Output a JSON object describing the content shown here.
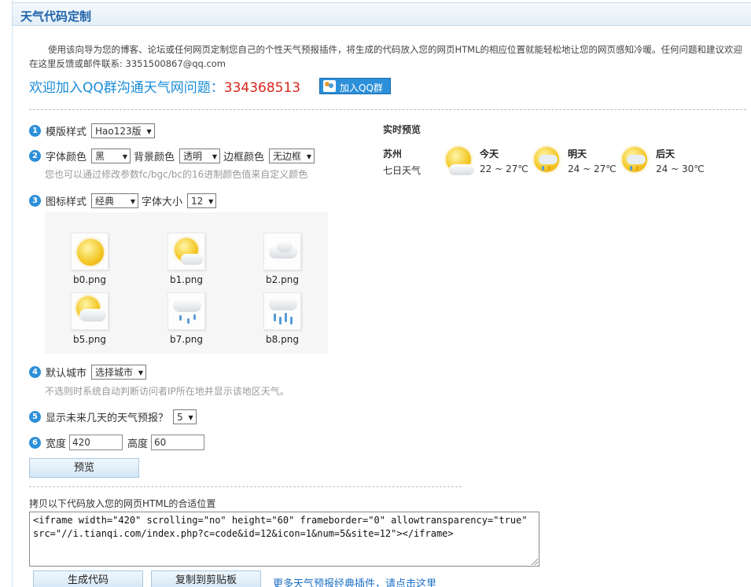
{
  "title": "天气代码定制",
  "intro": "使用该向导为您的博客、论坛或任何网页定制您自己的个性天气预报插件，将生成的代码放入您的网页HTML的相应位置就能轻松地让您的网页感知冷暖。任何问题和建议欢迎在这里反馈或邮件联系: 3351500867@qq.com",
  "qq": {
    "text": "欢迎加入QQ群沟通天气网问题：",
    "number": "334368513",
    "button": "加入QQ群"
  },
  "step1": {
    "num": "1",
    "label": "模版样式",
    "select": "Hao123版"
  },
  "step2": {
    "num": "2",
    "font_color_label": "字体颜色",
    "font_color": "黑",
    "bg_color_label": "背景颜色",
    "bg_color": "透明",
    "border_color_label": "边框颜色",
    "border_color": "无边框",
    "hint": "您也可以通过修改参数fc/bgc/bc的16进制颜色值来自定义颜色"
  },
  "step3": {
    "num": "3",
    "label": "图标样式",
    "select": "经典",
    "size_label": "字体大小",
    "size": "12",
    "icons": [
      {
        "file": "b0.png",
        "icon": "sunny-icon"
      },
      {
        "file": "b1.png",
        "icon": "sun-cloud-icon"
      },
      {
        "file": "b2.png",
        "icon": "cloudy-icon"
      },
      {
        "file": "b5.png",
        "icon": "partly-cloudy-icon"
      },
      {
        "file": "b7.png",
        "icon": "light-rain-icon"
      },
      {
        "file": "b8.png",
        "icon": "rain-icon"
      }
    ]
  },
  "step4": {
    "num": "4",
    "label": "默认城市",
    "select": "选择城市",
    "hint": "不选则时系统自动判断访问者IP所在地并显示该地区天气。"
  },
  "step5": {
    "num": "5",
    "label": "显示未来几天的天气预报？",
    "select": "5"
  },
  "step6": {
    "num": "6",
    "width_label": "宽度",
    "width": "420",
    "height_label": "高度",
    "height": "60"
  },
  "preview_button": "预览",
  "code_label": "拷贝以下代码放入您的网页HTML的合适位置",
  "code": "<iframe width=\"420\" scrolling=\"no\" height=\"60\" frameborder=\"0\" allowtransparency=\"true\" src=\"//i.tianqi.com/index.php?c=code&id=12&icon=1&num=5&site=12\"></iframe>",
  "generate_button": "生成代码",
  "copy_button": "复制到剪贴板",
  "more_link": "更多天气预报经典插件，请点击这里",
  "preview": {
    "title": "实时预览",
    "city": "苏州",
    "sub": "七日天气",
    "days": [
      {
        "name": "今天",
        "range": "22 ~ 27℃",
        "icon": "sun-cloud-icon"
      },
      {
        "name": "明天",
        "range": "24 ~ 27℃",
        "icon": "thunder-rain-icon"
      },
      {
        "name": "后天",
        "range": "24 ~ 30℃",
        "icon": "thunder-rain-icon"
      }
    ]
  },
  "colors": {
    "accent": "#2c8fd9",
    "title": "#1f62a8",
    "qq_number": "#d9261c",
    "link": "#1a6fc4"
  }
}
